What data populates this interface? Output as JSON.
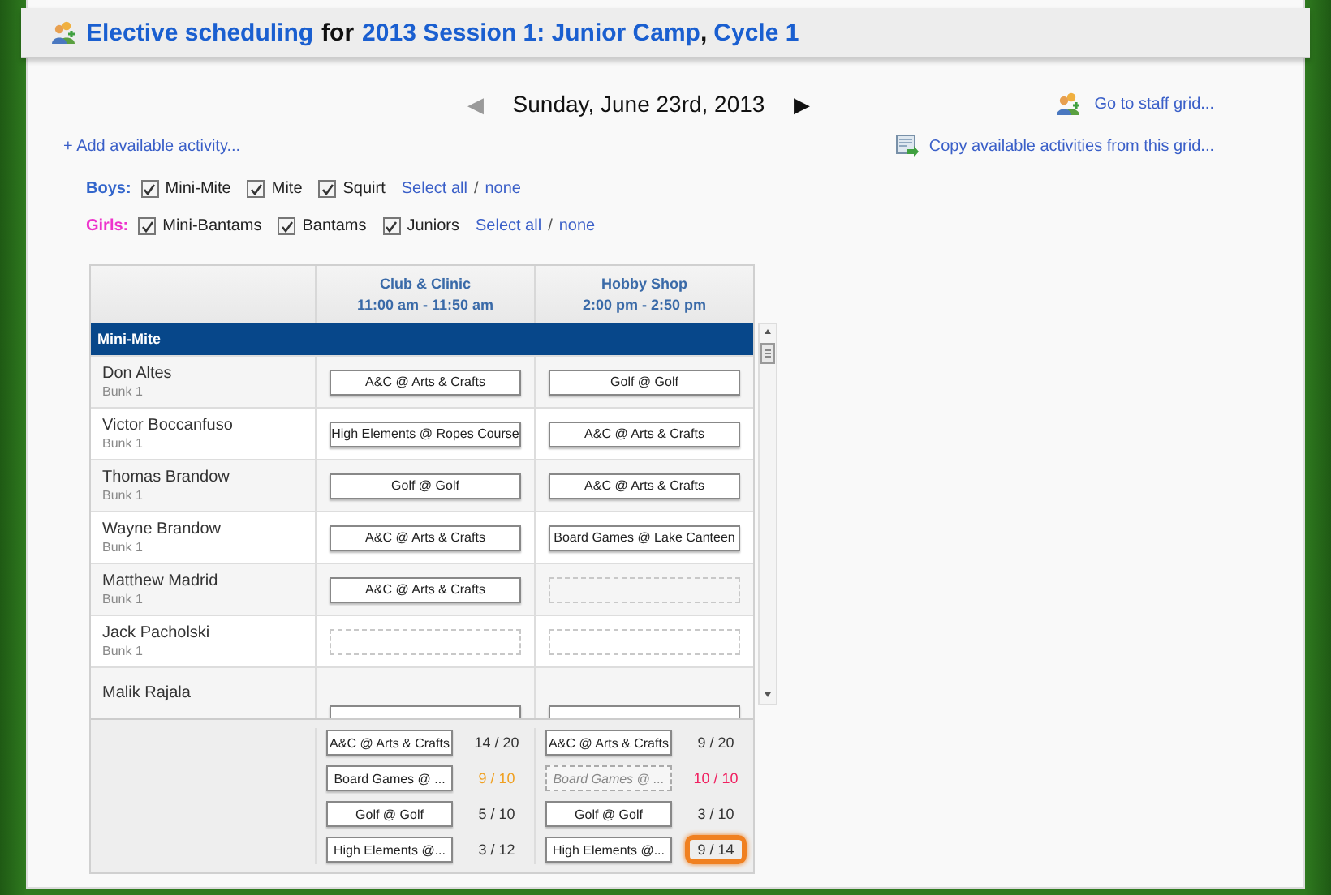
{
  "header": {
    "title_link": "Elective scheduling",
    "connector": "for",
    "session_link": "2013 Session 1: Junior Camp",
    "separator": ",",
    "cycle_link": "Cycle 1"
  },
  "date_nav": {
    "prev": "◀",
    "prev_disabled": true,
    "date": "Sunday, June 23rd, 2013",
    "next": "▶",
    "next_disabled": false
  },
  "links": {
    "staff_grid": "Go to staff grid...",
    "add_activity": "+ Add available activity...",
    "copy_activities": "Copy available activities from this grid..."
  },
  "filters": [
    {
      "label": "Boys:",
      "color": "#3366cc",
      "options": [
        {
          "label": "Mini-Mite",
          "checked": true
        },
        {
          "label": "Mite",
          "checked": true
        },
        {
          "label": "Squirt",
          "checked": true
        }
      ],
      "select_all": "Select all",
      "slash": "/",
      "select_none": "none"
    },
    {
      "label": "Girls:",
      "color": "#ee33cc",
      "options": [
        {
          "label": "Mini-Bantams",
          "checked": true
        },
        {
          "label": "Bantams",
          "checked": true
        },
        {
          "label": "Juniors",
          "checked": true
        }
      ],
      "select_all": "Select all",
      "slash": "/",
      "select_none": "none"
    }
  ],
  "grid": {
    "columns": [
      {
        "name": "Club & Clinic",
        "time": "11:00 am - 11:50 am"
      },
      {
        "name": "Hobby Shop",
        "time": "2:00 pm - 2:50 pm"
      }
    ],
    "group": "Mini-Mite",
    "rows": [
      {
        "name": "Don Altes",
        "bunk": "Bunk 1",
        "cells": [
          {
            "kind": "assigned",
            "activity": "A&C @ Arts & Crafts"
          },
          {
            "kind": "assigned",
            "activity": "Golf @ Golf"
          }
        ]
      },
      {
        "name": "Victor Boccanfuso",
        "bunk": "Bunk 1",
        "cells": [
          {
            "kind": "assigned",
            "activity": "High Elements @ Ropes Course"
          },
          {
            "kind": "assigned",
            "activity": "A&C @ Arts & Crafts"
          }
        ]
      },
      {
        "name": "Thomas Brandow",
        "bunk": "Bunk 1",
        "cells": [
          {
            "kind": "assigned",
            "activity": "Golf @ Golf"
          },
          {
            "kind": "assigned",
            "activity": "A&C @ Arts & Crafts"
          }
        ]
      },
      {
        "name": "Wayne Brandow",
        "bunk": "Bunk 1",
        "cells": [
          {
            "kind": "assigned",
            "activity": "A&C @ Arts & Crafts"
          },
          {
            "kind": "assigned",
            "activity": "Board Games @ Lake Canteen"
          }
        ]
      },
      {
        "name": "Matthew Madrid",
        "bunk": "Bunk 1",
        "cells": [
          {
            "kind": "assigned",
            "activity": "A&C @ Arts & Crafts"
          },
          {
            "kind": "empty"
          }
        ]
      },
      {
        "name": "Jack Pacholski",
        "bunk": "Bunk 1",
        "cells": [
          {
            "kind": "empty"
          },
          {
            "kind": "empty"
          }
        ]
      },
      {
        "name": "Malik Rajala",
        "cells": [
          {
            "kind": "obscured"
          },
          {
            "kind": "obscured"
          }
        ]
      }
    ],
    "summary": [
      [
        {
          "label": "A&C @ Arts & Crafts",
          "count": "14 / 20",
          "near_full": false,
          "full": false,
          "highlighted": false
        },
        {
          "label": "Board Games @ ...",
          "count": "9 / 10",
          "near_full": true,
          "full": false,
          "highlighted": false
        },
        {
          "label": "Golf @ Golf",
          "count": "5 / 10",
          "near_full": false,
          "full": false,
          "highlighted": false
        },
        {
          "label": "High Elements @...",
          "count": "3 / 12",
          "near_full": false,
          "full": false,
          "highlighted": false
        }
      ],
      [
        {
          "label": "A&C @ Arts & Crafts",
          "count": "9 / 20",
          "near_full": false,
          "full": false,
          "highlighted": false
        },
        {
          "label": "Board Games @ ...",
          "count": "10 / 10",
          "near_full": false,
          "full": true,
          "highlighted": false
        },
        {
          "label": "Golf @ Golf",
          "count": "3 / 10",
          "near_full": false,
          "full": false,
          "highlighted": false
        },
        {
          "label": "High Elements @...",
          "count": "9 / 14",
          "near_full": false,
          "full": false,
          "highlighted": true
        }
      ]
    ]
  }
}
